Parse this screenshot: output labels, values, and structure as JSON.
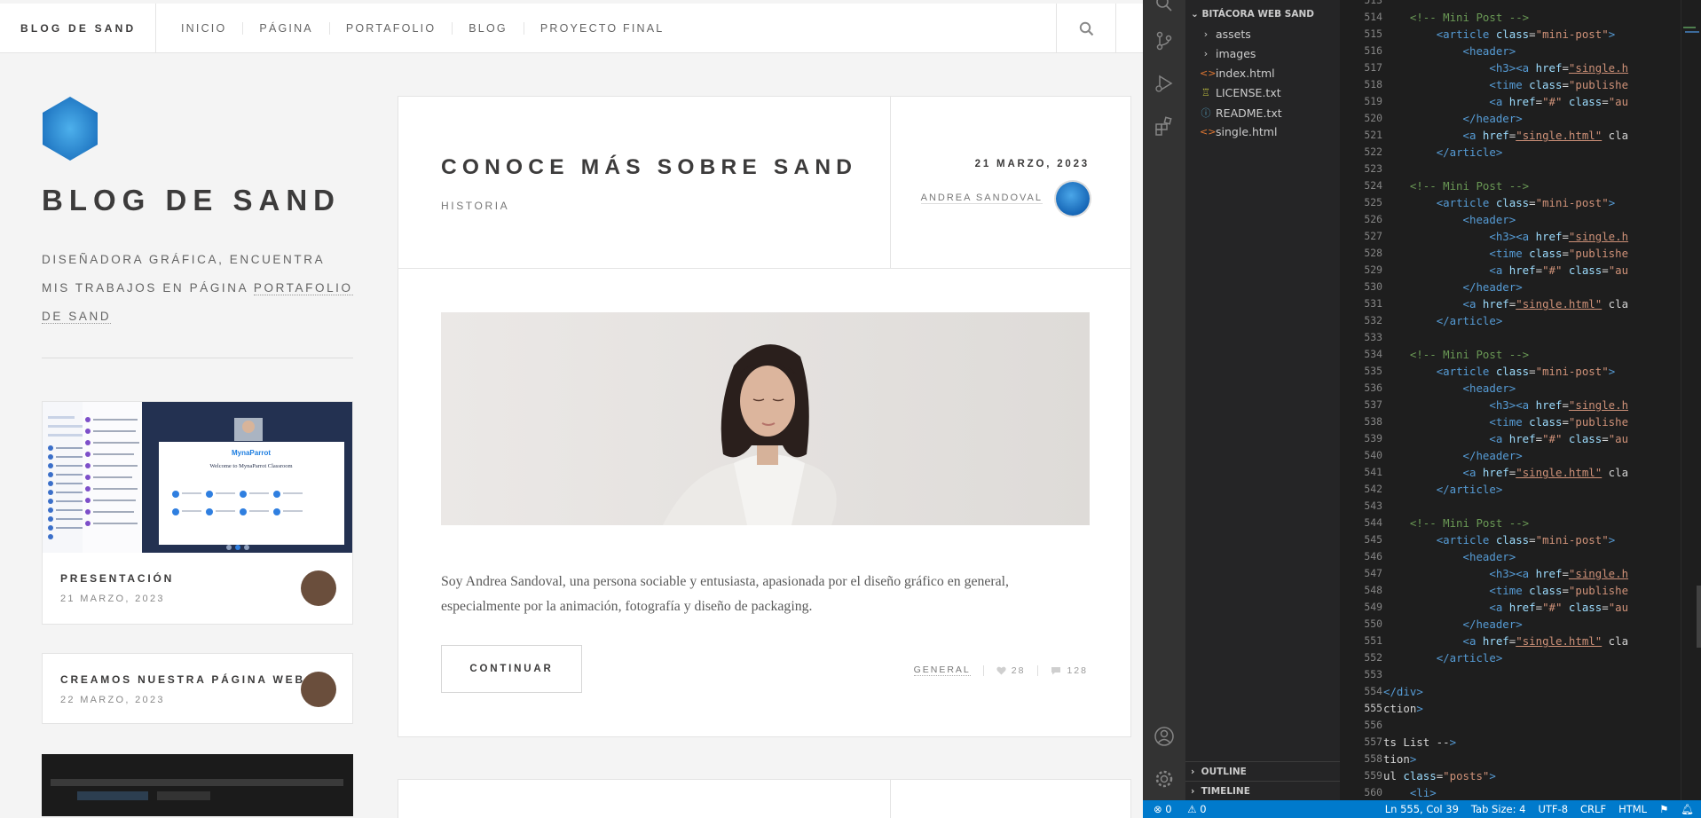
{
  "site": {
    "brand": "BLOG DE SAND",
    "nav": [
      "INICIO",
      "PÁGINA",
      "PORTAFOLIO",
      "BLOG",
      "PROYECTO FINAL"
    ],
    "sidebar": {
      "title": "BLOG DE SAND",
      "desc": "DISEÑADORA GRÁFICA, ENCUENTRA MIS TRABAJOS EN PÁGINA ",
      "desc_link": "PORTAFOLIO DE SAND",
      "minis": [
        {
          "title": "PRESENTACIÓN",
          "date": "21 MARZO, 2023"
        },
        {
          "title": "CREAMOS NUESTRA PÁGINA WEB",
          "date": "22 MARZO, 2023"
        }
      ],
      "thumb_text": {
        "brand": "MynaParrot",
        "welcome": "Welcome to MynaParrot Classroom"
      }
    },
    "post": {
      "title": "CONOCE MÁS SOBRE SAND",
      "subtitle": "HISTORIA",
      "date": "21 MARZO, 2023",
      "author": "ANDREA SANDOVAL",
      "text": "Soy Andrea Sandoval, una persona sociable y entusiasta, apasionada por el diseño gráfico en general, especialmente por la animación, fotografía y diseño de packaging.",
      "button": "CONTINUAR",
      "category": "GENERAL",
      "likes": "28",
      "comments": "128"
    }
  },
  "vscode": {
    "explorer": {
      "root": "BITÁCORA WEB SAND",
      "items": [
        {
          "name": "assets",
          "type": "folder"
        },
        {
          "name": "images",
          "type": "folder"
        },
        {
          "name": "index.html",
          "type": "html"
        },
        {
          "name": "LICENSE.txt",
          "type": "license"
        },
        {
          "name": "README.txt",
          "type": "info"
        },
        {
          "name": "single.html",
          "type": "html"
        }
      ],
      "outline": "OUTLINE",
      "timeline": "TIMELINE"
    },
    "status": {
      "errors": "0",
      "warnings": "0",
      "position": "Ln 555, Col 39",
      "tab": "Tab Size: 4",
      "encoding": "UTF-8",
      "eol": "CRLF",
      "language": "HTML"
    },
    "current_line": 555,
    "code": [
      {
        "n": 513,
        "t": ""
      },
      {
        "n": 514,
        "t": "    <!-- Mini Post -->"
      },
      {
        "n": 515,
        "t": "        <article class=\"mini-post\">"
      },
      {
        "n": 516,
        "t": "            <header>"
      },
      {
        "n": 517,
        "t": "                <h3><a href=\"single.h"
      },
      {
        "n": 518,
        "t": "                <time class=\"publishe"
      },
      {
        "n": 519,
        "t": "                <a href=\"#\" class=\"au"
      },
      {
        "n": 520,
        "t": "            </header>"
      },
      {
        "n": 521,
        "t": "            <a href=\"single.html\" cla"
      },
      {
        "n": 522,
        "t": "        </article>"
      },
      {
        "n": 523,
        "t": ""
      },
      {
        "n": 524,
        "t": "    <!-- Mini Post -->"
      },
      {
        "n": 525,
        "t": "        <article class=\"mini-post\">"
      },
      {
        "n": 526,
        "t": "            <header>"
      },
      {
        "n": 527,
        "t": "                <h3><a href=\"single.h"
      },
      {
        "n": 528,
        "t": "                <time class=\"publishe"
      },
      {
        "n": 529,
        "t": "                <a href=\"#\" class=\"au"
      },
      {
        "n": 530,
        "t": "            </header>"
      },
      {
        "n": 531,
        "t": "            <a href=\"single.html\" cla"
      },
      {
        "n": 532,
        "t": "        </article>"
      },
      {
        "n": 533,
        "t": ""
      },
      {
        "n": 534,
        "t": "    <!-- Mini Post -->"
      },
      {
        "n": 535,
        "t": "        <article class=\"mini-post\">"
      },
      {
        "n": 536,
        "t": "            <header>"
      },
      {
        "n": 537,
        "t": "                <h3><a href=\"single.h"
      },
      {
        "n": 538,
        "t": "                <time class=\"publishe"
      },
      {
        "n": 539,
        "t": "                <a href=\"#\" class=\"au"
      },
      {
        "n": 540,
        "t": "            </header>"
      },
      {
        "n": 541,
        "t": "            <a href=\"single.html\" cla"
      },
      {
        "n": 542,
        "t": "        </article>"
      },
      {
        "n": 543,
        "t": ""
      },
      {
        "n": 544,
        "t": "    <!-- Mini Post -->"
      },
      {
        "n": 545,
        "t": "        <article class=\"mini-post\">"
      },
      {
        "n": 546,
        "t": "            <header>"
      },
      {
        "n": 547,
        "t": "                <h3><a href=\"single.h"
      },
      {
        "n": 548,
        "t": "                <time class=\"publishe"
      },
      {
        "n": 549,
        "t": "                <a href=\"#\" class=\"au"
      },
      {
        "n": 550,
        "t": "            </header>"
      },
      {
        "n": 551,
        "t": "            <a href=\"single.html\" cla"
      },
      {
        "n": 552,
        "t": "        </article>"
      },
      {
        "n": 553,
        "t": ""
      },
      {
        "n": 554,
        "t": "</div>"
      },
      {
        "n": 555,
        "t": "ction>"
      },
      {
        "n": 556,
        "t": ""
      },
      {
        "n": 557,
        "t": "ts List -->"
      },
      {
        "n": 558,
        "t": "tion>"
      },
      {
        "n": 559,
        "t": "ul class=\"posts\">"
      },
      {
        "n": 560,
        "t": "    <li>"
      }
    ]
  },
  "colors": {
    "accent": "#2b8fd6",
    "statusbar": "#007acc",
    "text": "#3c3b3b"
  }
}
